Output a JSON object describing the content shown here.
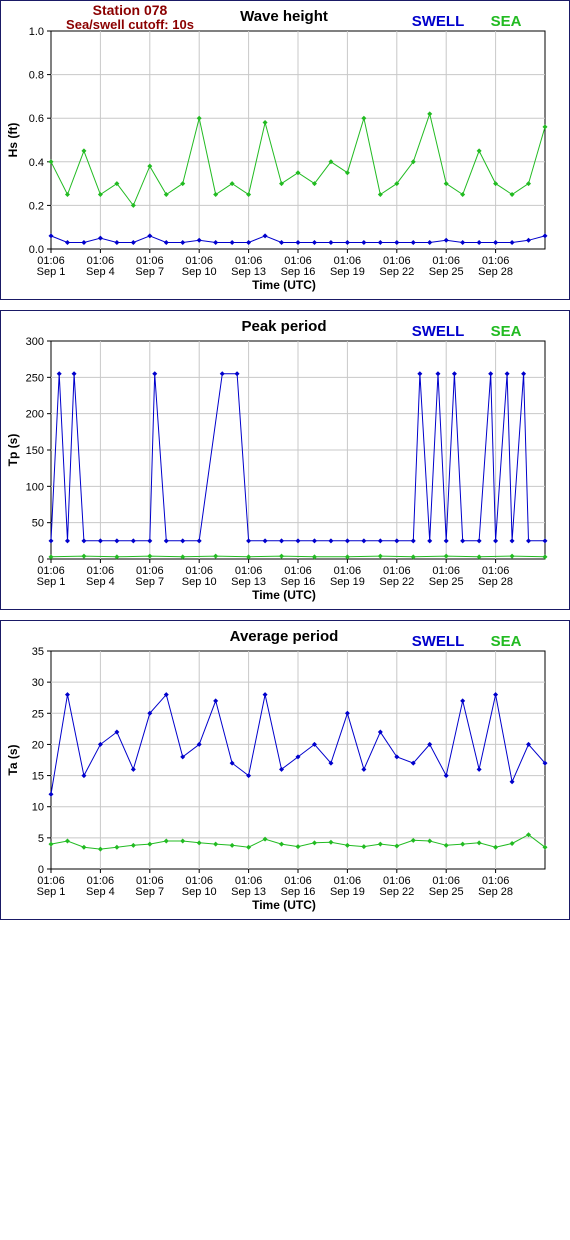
{
  "header": {
    "station": "Station 078",
    "cutoff": "Sea/swell cutoff: 10s"
  },
  "colors": {
    "swell": "#0000cc",
    "sea": "#22bb22",
    "border": "#1a1a66",
    "grid": "#c8c8c8"
  },
  "chart_data": [
    {
      "type": "line",
      "title": "Wave height",
      "ylabel": "Hs (ft)",
      "xlabel": "Time (UTC)",
      "ylim": [
        0,
        1.0
      ],
      "yticks": [
        "0.0",
        "0.2",
        "0.4",
        "0.6",
        "0.8",
        "1.0"
      ],
      "xticks_top": [
        "01:06",
        "01:06",
        "01:06",
        "01:06",
        "01:06",
        "01:06",
        "01:06",
        "01:06",
        "01:06",
        "01:06"
      ],
      "xticks_bottom": [
        "Sep 1",
        "Sep 4",
        "Sep 7",
        "Sep 10",
        "Sep 13",
        "Sep 16",
        "Sep 19",
        "Sep 22",
        "Sep 25",
        "Sep 28"
      ],
      "xlim_days": [
        0,
        30
      ],
      "grid": true,
      "legend": "top-right",
      "series": [
        {
          "name": "SWELL",
          "color": "#0000cc",
          "t": [
            0,
            1,
            2,
            3,
            4,
            5,
            6,
            7,
            8,
            9,
            10,
            11,
            12,
            13,
            14,
            15,
            16,
            17,
            18,
            19,
            20,
            21,
            22,
            23,
            24,
            25,
            26,
            27,
            28,
            29,
            30
          ],
          "values": [
            0.06,
            0.03,
            0.03,
            0.05,
            0.03,
            0.03,
            0.06,
            0.03,
            0.03,
            0.04,
            0.03,
            0.03,
            0.03,
            0.06,
            0.03,
            0.03,
            0.03,
            0.03,
            0.03,
            0.03,
            0.03,
            0.03,
            0.03,
            0.03,
            0.04,
            0.03,
            0.03,
            0.03,
            0.03,
            0.04,
            0.06
          ]
        },
        {
          "name": "SEA",
          "color": "#22bb22",
          "t": [
            0,
            1,
            2,
            3,
            4,
            5,
            6,
            7,
            8,
            9,
            10,
            11,
            12,
            13,
            14,
            15,
            16,
            17,
            18,
            19,
            20,
            21,
            22,
            23,
            24,
            25,
            26,
            27,
            28,
            29,
            30
          ],
          "values": [
            0.4,
            0.25,
            0.45,
            0.25,
            0.3,
            0.2,
            0.38,
            0.25,
            0.3,
            0.6,
            0.25,
            0.3,
            0.25,
            0.58,
            0.3,
            0.35,
            0.3,
            0.4,
            0.35,
            0.6,
            0.25,
            0.3,
            0.4,
            0.62,
            0.3,
            0.25,
            0.45,
            0.3,
            0.25,
            0.3,
            0.56
          ]
        }
      ]
    },
    {
      "type": "line",
      "title": "Peak period",
      "ylabel": "Tp (s)",
      "xlabel": "Time (UTC)",
      "ylim": [
        0,
        300
      ],
      "yticks": [
        "0",
        "50",
        "100",
        "150",
        "200",
        "250",
        "300"
      ],
      "xticks_top": [
        "01:06",
        "01:06",
        "01:06",
        "01:06",
        "01:06",
        "01:06",
        "01:06",
        "01:06",
        "01:06",
        "01:06"
      ],
      "xticks_bottom": [
        "Sep 1",
        "Sep 4",
        "Sep 7",
        "Sep 10",
        "Sep 13",
        "Sep 16",
        "Sep 19",
        "Sep 22",
        "Sep 25",
        "Sep 28"
      ],
      "xlim_days": [
        0,
        30
      ],
      "grid": true,
      "legend": "top-right",
      "series": [
        {
          "name": "SWELL",
          "color": "#0000cc",
          "t": [
            0,
            0.5,
            1.0,
            1.4,
            2.0,
            3.0,
            4.0,
            5.0,
            6.0,
            6.3,
            7.0,
            8.0,
            9.0,
            10.4,
            11.3,
            12.0,
            13.0,
            14.0,
            15.0,
            16.0,
            17.0,
            18.0,
            19.0,
            20.0,
            21.0,
            22.0,
            22.4,
            23.0,
            23.5,
            24.0,
            24.5,
            25.0,
            26.0,
            26.7,
            27.0,
            27.7,
            28.0,
            28.7,
            29.0,
            30.0
          ],
          "values": [
            25,
            255,
            25,
            255,
            25,
            25,
            25,
            25,
            25,
            255,
            25,
            25,
            25,
            255,
            255,
            25,
            25,
            25,
            25,
            25,
            25,
            25,
            25,
            25,
            25,
            25,
            255,
            25,
            255,
            25,
            255,
            25,
            25,
            255,
            25,
            255,
            25,
            255,
            25,
            25
          ]
        },
        {
          "name": "SEA",
          "color": "#22bb22",
          "t": [
            0,
            2,
            4,
            6,
            8,
            10,
            12,
            14,
            16,
            18,
            20,
            22,
            24,
            26,
            28,
            30
          ],
          "values": [
            3,
            4,
            3,
            4,
            3,
            4,
            3,
            4,
            3,
            3,
            4,
            3,
            4,
            3,
            4,
            3
          ]
        }
      ]
    },
    {
      "type": "line",
      "title": "Average period",
      "ylabel": "Ta (s)",
      "xlabel": "Time (UTC)",
      "ylim": [
        0,
        35
      ],
      "yticks": [
        "0",
        "5",
        "10",
        "15",
        "20",
        "25",
        "30",
        "35"
      ],
      "xticks_top": [
        "01:06",
        "01:06",
        "01:06",
        "01:06",
        "01:06",
        "01:06",
        "01:06",
        "01:06",
        "01:06",
        "01:06"
      ],
      "xticks_bottom": [
        "Sep 1",
        "Sep 4",
        "Sep 7",
        "Sep 10",
        "Sep 13",
        "Sep 16",
        "Sep 19",
        "Sep 22",
        "Sep 25",
        "Sep 28"
      ],
      "xlim_days": [
        0,
        30
      ],
      "grid": true,
      "legend": "top-right",
      "series": [
        {
          "name": "SWELL",
          "color": "#0000cc",
          "t": [
            0,
            1,
            2,
            3,
            4,
            5,
            6,
            7,
            8,
            9,
            10,
            11,
            12,
            13,
            14,
            15,
            16,
            17,
            18,
            19,
            20,
            21,
            22,
            23,
            24,
            25,
            26,
            27,
            28,
            29,
            30
          ],
          "values": [
            12,
            28,
            15,
            20,
            22,
            16,
            25,
            28,
            18,
            20,
            27,
            17,
            15,
            28,
            16,
            18,
            20,
            17,
            25,
            16,
            22,
            18,
            17,
            20,
            15,
            27,
            16,
            28,
            14,
            20,
            17
          ]
        },
        {
          "name": "SEA",
          "color": "#22bb22",
          "t": [
            0,
            1,
            2,
            3,
            4,
            5,
            6,
            7,
            8,
            9,
            10,
            11,
            12,
            13,
            14,
            15,
            16,
            17,
            18,
            19,
            20,
            21,
            22,
            23,
            24,
            25,
            26,
            27,
            28,
            29,
            30
          ],
          "values": [
            4,
            4.5,
            3.5,
            3.2,
            3.5,
            3.8,
            4,
            4.5,
            4.5,
            4.2,
            4,
            3.8,
            3.5,
            4.8,
            4,
            3.6,
            4.2,
            4.3,
            3.8,
            3.6,
            4,
            3.7,
            4.6,
            4.5,
            3.8,
            4,
            4.2,
            3.5,
            4.1,
            5.5,
            3.5
          ]
        }
      ]
    }
  ]
}
